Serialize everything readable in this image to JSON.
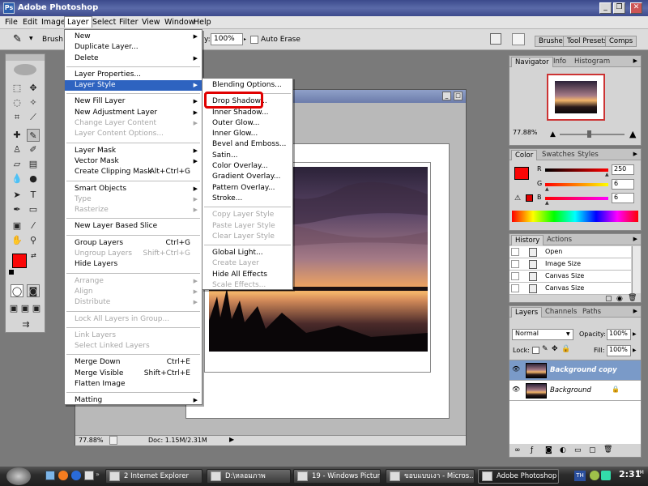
{
  "window": {
    "title": "Adobe Photoshop",
    "logo_text": "Ps"
  },
  "window_controls": {
    "minimize": "_",
    "restore": "❐",
    "close": "✕"
  },
  "menubar": [
    "File",
    "Edit",
    "Image",
    "Layer",
    "Select",
    "Filter",
    "View",
    "Window",
    "Help"
  ],
  "menubar_active": "Layer",
  "options": {
    "brush_label": "Brush:",
    "opacity_label": "y:",
    "opacity_value": "100%",
    "auto_erase": "Auto Erase",
    "palette_tabs": [
      "Brushes",
      "Tool Presets",
      "Comps"
    ]
  },
  "layer_menu": [
    {
      "label": "New",
      "submenu": true
    },
    {
      "label": "Duplicate Layer..."
    },
    {
      "label": "Delete",
      "submenu": true
    },
    {
      "sep": true
    },
    {
      "label": "Layer Properties..."
    },
    {
      "label": "Layer Style",
      "submenu": true,
      "highlighted": true
    },
    {
      "sep": true
    },
    {
      "label": "New Fill Layer",
      "submenu": true
    },
    {
      "label": "New Adjustment Layer",
      "submenu": true
    },
    {
      "label": "Change Layer Content",
      "submenu": true,
      "disabled": true
    },
    {
      "label": "Layer Content Options...",
      "disabled": true
    },
    {
      "sep": true
    },
    {
      "label": "Layer Mask",
      "submenu": true
    },
    {
      "label": "Vector Mask",
      "submenu": true
    },
    {
      "label": "Create Clipping Mask",
      "shortcut": "Alt+Ctrl+G"
    },
    {
      "sep": true
    },
    {
      "label": "Smart Objects",
      "submenu": true
    },
    {
      "label": "Type",
      "submenu": true,
      "disabled": true
    },
    {
      "label": "Rasterize",
      "submenu": true,
      "disabled": true
    },
    {
      "sep": true
    },
    {
      "label": "New Layer Based Slice"
    },
    {
      "sep": true
    },
    {
      "label": "Group Layers",
      "shortcut": "Ctrl+G"
    },
    {
      "label": "Ungroup Layers",
      "shortcut": "Shift+Ctrl+G",
      "disabled": true
    },
    {
      "label": "Hide Layers"
    },
    {
      "sep": true
    },
    {
      "label": "Arrange",
      "submenu": true,
      "disabled": true
    },
    {
      "label": "Align",
      "submenu": true,
      "disabled": true
    },
    {
      "label": "Distribute",
      "submenu": true,
      "disabled": true
    },
    {
      "sep": true
    },
    {
      "label": "Lock All Layers in Group...",
      "disabled": true
    },
    {
      "sep": true
    },
    {
      "label": "Link Layers",
      "disabled": true
    },
    {
      "label": "Select Linked Layers",
      "disabled": true
    },
    {
      "sep": true
    },
    {
      "label": "Merge Down",
      "shortcut": "Ctrl+E"
    },
    {
      "label": "Merge Visible",
      "shortcut": "Shift+Ctrl+E"
    },
    {
      "label": "Flatten Image"
    },
    {
      "sep": true
    },
    {
      "label": "Matting",
      "submenu": true
    }
  ],
  "style_menu": [
    {
      "label": "Blending Options..."
    },
    {
      "sep": true
    },
    {
      "label": "Drop Shadow...",
      "callout": true
    },
    {
      "label": "Inner Shadow..."
    },
    {
      "label": "Outer Glow..."
    },
    {
      "label": "Inner Glow..."
    },
    {
      "label": "Bevel and Emboss..."
    },
    {
      "label": "Satin..."
    },
    {
      "label": "Color Overlay..."
    },
    {
      "label": "Gradient Overlay..."
    },
    {
      "label": "Pattern Overlay..."
    },
    {
      "label": "Stroke..."
    },
    {
      "sep": true
    },
    {
      "label": "Copy Layer Style",
      "disabled": true
    },
    {
      "label": "Paste Layer Style",
      "disabled": true
    },
    {
      "label": "Clear Layer Style",
      "disabled": true
    },
    {
      "sep": true
    },
    {
      "label": "Global Light..."
    },
    {
      "label": "Create Layer",
      "disabled": true
    },
    {
      "label": "Hide All Effects"
    },
    {
      "label": "Scale Effects...",
      "disabled": true
    }
  ],
  "document": {
    "zoom": "77.88%",
    "doc_info": "Doc: 1.15M/2.31M"
  },
  "navigator": {
    "tabs": [
      "Navigator",
      "Info",
      "Histogram"
    ],
    "zoom": "77.88%"
  },
  "color": {
    "tabs": [
      "Color",
      "Swatches",
      "Styles"
    ],
    "r_label": "R",
    "g_label": "G",
    "b_label": "B",
    "r": "250",
    "g": "6",
    "b": "6",
    "foreground": "#fa0606"
  },
  "history": {
    "tabs": [
      "History",
      "Actions"
    ],
    "items": [
      "Open",
      "Image Size",
      "Canvas Size",
      "Canvas Size"
    ]
  },
  "layers": {
    "tabs": [
      "Layers",
      "Channels",
      "Paths"
    ],
    "blend_mode": "Normal",
    "opacity_label": "Opacity:",
    "opacity": "100%",
    "lock_label": "Lock:",
    "fill_label": "Fill:",
    "fill": "100%",
    "items": [
      {
        "name": "Background copy",
        "selected": true
      },
      {
        "name": "Background",
        "selected": false
      }
    ]
  },
  "taskbar": {
    "buttons": [
      "2 Internet Explorer",
      "D:\\หลอมภาพ",
      "19 - Windows Pictur...",
      "ขอบแบบเงา - Micros...",
      "Adobe Photoshop"
    ],
    "active": "Adobe Photoshop",
    "lang": "TH",
    "clock_time": "2:31",
    "clock_suffix": "PM"
  },
  "colors": {
    "accent": "#2e63c0",
    "callout": "#e00000",
    "title_bar": "#3c4a8c"
  }
}
